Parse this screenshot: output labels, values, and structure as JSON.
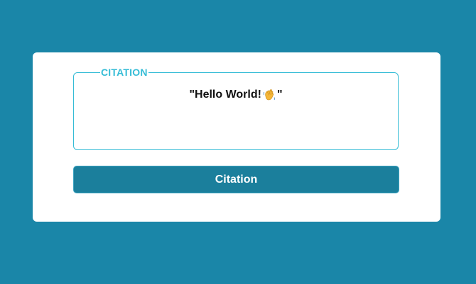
{
  "card": {
    "legend": "CITATION",
    "quote": {
      "open": "\"Hello World!",
      "icon": "waving-hand-icon",
      "close": "\""
    },
    "button_label": "Citation"
  },
  "colors": {
    "background": "#1a86a8",
    "accent": "#35bcd6",
    "button": "#1b7f9c"
  }
}
